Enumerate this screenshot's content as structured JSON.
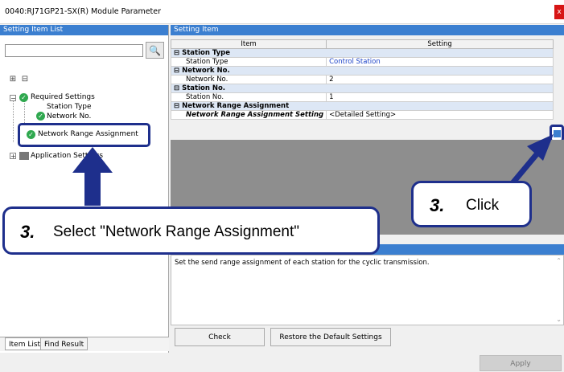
{
  "window": {
    "title": "0040:RJ71GP21-SX(R) Module Parameter",
    "close_glyph": "x"
  },
  "left_panel": {
    "header": "Setting Item List",
    "search_value": "",
    "tree": [
      {
        "label": "Required Settings"
      },
      {
        "label": "Station Type"
      },
      {
        "label": "Network No."
      },
      {
        "label": "Network Range Assignment"
      },
      {
        "label": "Application Settings"
      }
    ],
    "tabs": [
      "Item List",
      "Find Result"
    ]
  },
  "right_panel": {
    "header": "Setting Item",
    "columns": [
      "Item",
      "Setting"
    ],
    "rows": [
      {
        "item": "Station Type",
        "setting": "",
        "category": true
      },
      {
        "item": "Station Type",
        "setting": "Control Station",
        "category": false
      },
      {
        "item": "Network No.",
        "setting": "",
        "category": true
      },
      {
        "item": "Network No.",
        "setting": "2",
        "category": false
      },
      {
        "item": "Station No.",
        "setting": "",
        "category": true
      },
      {
        "item": "Station No.",
        "setting": "1",
        "category": false
      },
      {
        "item": "Network Range Assignment",
        "setting": "",
        "category": true
      },
      {
        "item": "Network Range Assignment Setting",
        "setting": "<Detailed Setting>",
        "category": false
      }
    ],
    "description": "Set the send range assignment of each station for the cyclic transmission.",
    "buttons": {
      "check": "Check",
      "restore": "Restore the Default Settings",
      "apply": "Apply"
    }
  },
  "callouts": {
    "select": {
      "num": "3.",
      "text": "Select \"Network Range Assignment\""
    },
    "click": {
      "num": "3.",
      "text": "Click"
    }
  },
  "colors": {
    "accent_navy": "#1e2f8c",
    "header_blue": "#3b7fd0",
    "check_green": "#2fa84f"
  }
}
